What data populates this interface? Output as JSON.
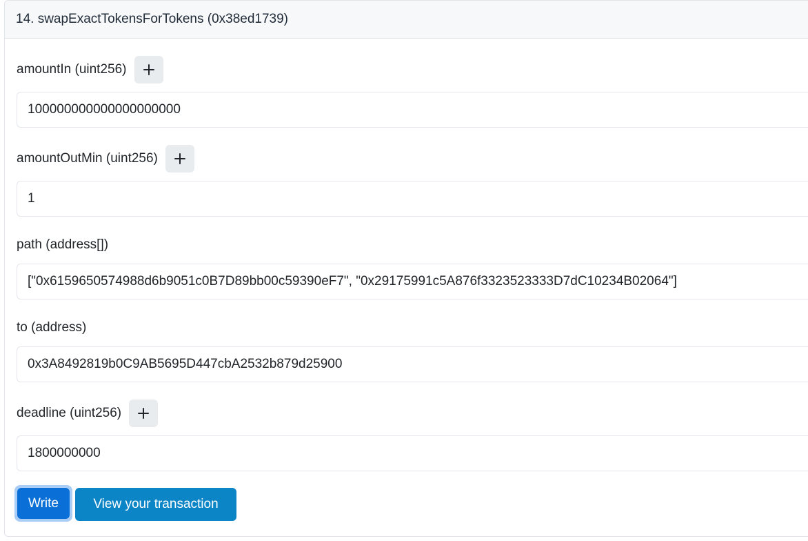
{
  "function": {
    "title": "14. swapExactTokensForTokens (0x38ed1739)"
  },
  "fields": [
    {
      "label": "amountIn (uint256)",
      "value": "100000000000000000000",
      "has_plus": true
    },
    {
      "label": "amountOutMin (uint256)",
      "value": "1",
      "has_plus": true
    },
    {
      "label": "path (address[])",
      "value": "[\"0x6159650574988d6b9051c0B7D89bb00c59390eF7\", \"0x29175991c5A876f3323523333D7dC10234B02064\"]",
      "has_plus": false
    },
    {
      "label": "to (address)",
      "value": "0x3A8492819b0C9AB5695D447cbA2532b879d25900",
      "has_plus": false
    },
    {
      "label": "deadline (uint256)",
      "value": "1800000000",
      "has_plus": true
    }
  ],
  "actions": {
    "write_label": "Write",
    "view_label": "View your transaction"
  },
  "icons": {
    "plus": "plus-icon"
  },
  "colors": {
    "write_button": "#0a6fd6",
    "view_button": "#0c85c7",
    "header_bg": "#f7f8fa"
  }
}
